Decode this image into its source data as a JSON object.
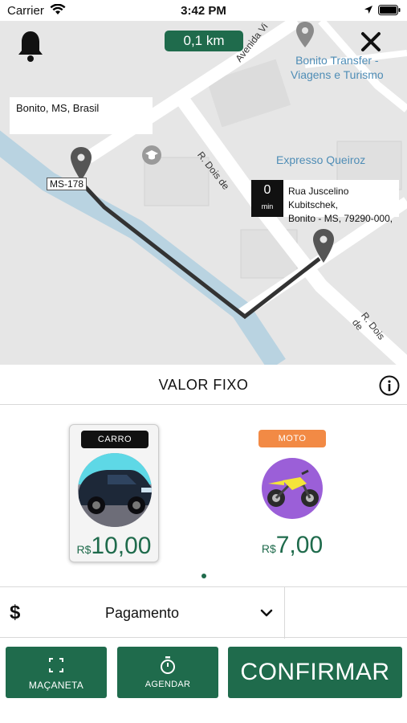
{
  "status_bar": {
    "carrier": "Carrier",
    "time": "3:42 PM",
    "icons": [
      "wifi-icon",
      "location-arrow-icon",
      "battery-icon"
    ]
  },
  "map": {
    "distance": "0,1 km",
    "origin_label": "Bonito, MS, Brasil",
    "road_tag": "MS-178",
    "destination": {
      "eta_value": "0",
      "eta_unit": "min",
      "address_line1": "Rua Juscelino Kubitschek,",
      "address_line2": "Bonito - MS, 79290-000,"
    },
    "poi": [
      {
        "line1": "Bonito Transfer -",
        "line2": "Viagens e Turismo"
      },
      {
        "line1": "Expresso Queiroz",
        "line2": ""
      }
    ],
    "streets": [
      "Avenida Vi",
      "R. Dois de",
      "R. Dois de"
    ],
    "icons": [
      "bell-icon",
      "close-icon",
      "map-pin-icon",
      "school-icon"
    ]
  },
  "fare": {
    "title": "VALOR FIXO",
    "info_icon": "info-icon"
  },
  "vehicles": [
    {
      "tag": "CARRO",
      "currency": "R$",
      "price": "10,00",
      "selected": true,
      "tag_color": "#111111",
      "icon": "car-icon"
    },
    {
      "tag": "MOTO",
      "currency": "R$",
      "price": "7,00",
      "selected": false,
      "tag_color": "#f28a45",
      "icon": "motorcycle-icon"
    }
  ],
  "payment": {
    "symbol": "$",
    "label": "Pagamento"
  },
  "buttons": {
    "macaneta": "MAÇANETA",
    "agendar": "AGENDAR",
    "confirmar": "CONFIRMAR"
  },
  "colors": {
    "brand_green": "#1f6b4c",
    "route": "#333333",
    "moto_tag": "#f28a45"
  }
}
